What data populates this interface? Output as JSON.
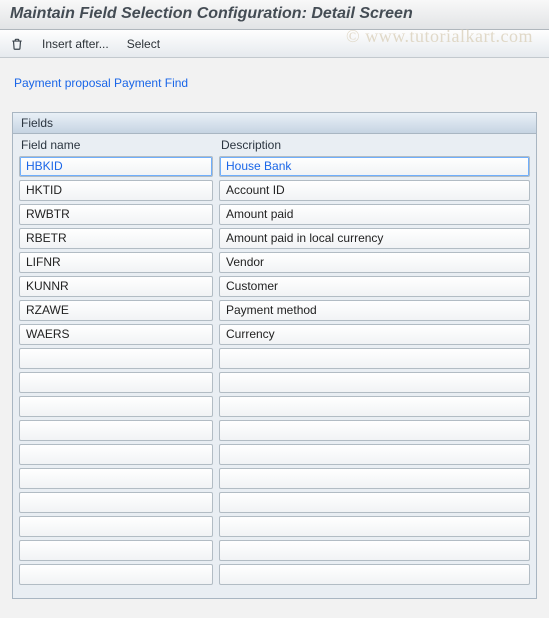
{
  "header": {
    "title": "Maintain Field Selection Configuration: Detail Screen"
  },
  "toolbar": {
    "delete_tooltip": "Delete",
    "insert_after": "Insert after...",
    "select": "Select"
  },
  "watermark": "© www.tutorialkart.com",
  "subheader": {
    "text": "Payment proposal Payment Find"
  },
  "panel": {
    "title": "Fields",
    "columns": {
      "name": "Field name",
      "desc": "Description"
    },
    "rows": [
      {
        "name": "HBKID",
        "desc": "House Bank",
        "selected": true
      },
      {
        "name": "HKTID",
        "desc": "Account ID"
      },
      {
        "name": "RWBTR",
        "desc": "Amount paid"
      },
      {
        "name": "RBETR",
        "desc": "Amount paid in local currency"
      },
      {
        "name": "LIFNR",
        "desc": "Vendor"
      },
      {
        "name": "KUNNR",
        "desc": "Customer"
      },
      {
        "name": "RZAWE",
        "desc": "Payment method"
      },
      {
        "name": "WAERS",
        "desc": "Currency"
      },
      {
        "name": "",
        "desc": ""
      },
      {
        "name": "",
        "desc": ""
      },
      {
        "name": "",
        "desc": ""
      },
      {
        "name": "",
        "desc": ""
      },
      {
        "name": "",
        "desc": ""
      },
      {
        "name": "",
        "desc": ""
      },
      {
        "name": "",
        "desc": ""
      },
      {
        "name": "",
        "desc": ""
      },
      {
        "name": "",
        "desc": ""
      },
      {
        "name": "",
        "desc": ""
      }
    ]
  }
}
